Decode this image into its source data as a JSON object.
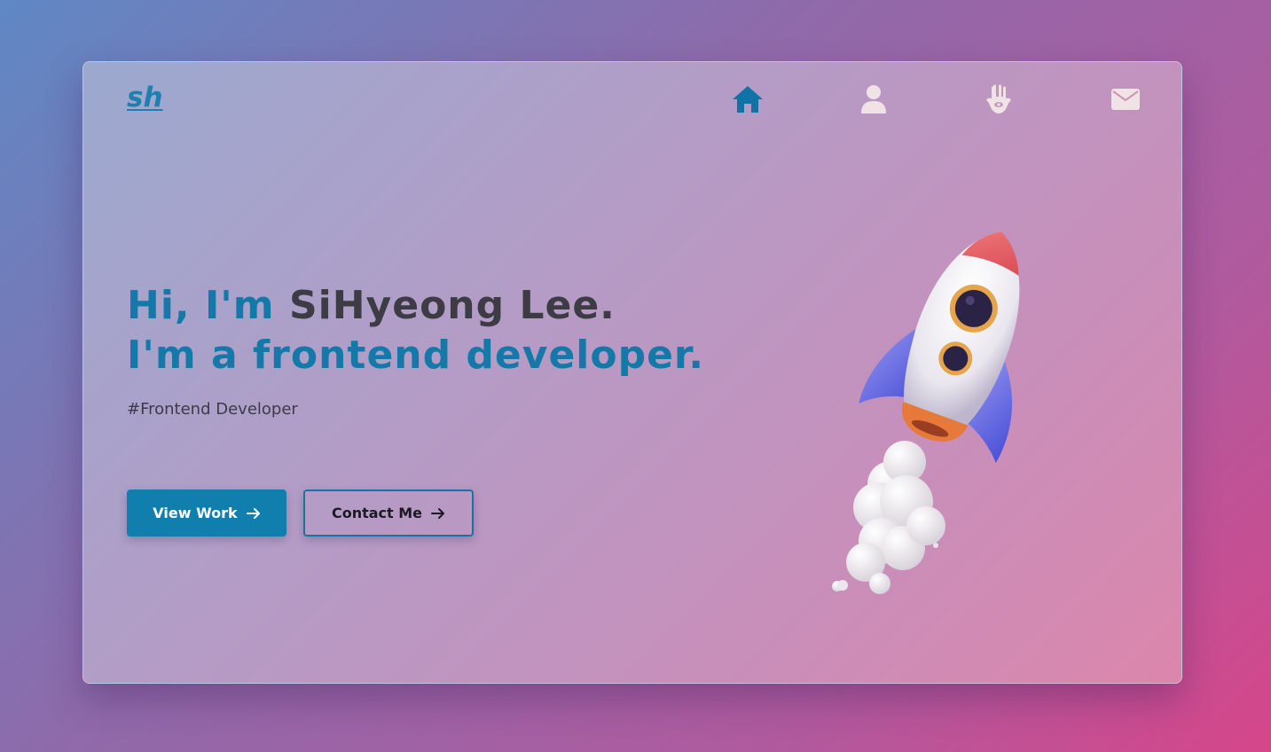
{
  "brand": {
    "logo": "sh"
  },
  "nav": {
    "items": [
      {
        "name": "home",
        "icon": "home-icon",
        "color": "#0f73a6"
      },
      {
        "name": "about",
        "icon": "user-icon",
        "color": "#f0e3e6"
      },
      {
        "name": "skills",
        "icon": "hamsa-icon",
        "color": "#f0e3e6"
      },
      {
        "name": "contact",
        "icon": "envelope-icon",
        "color": "#f0e3e6"
      }
    ]
  },
  "hero": {
    "greeting": "Hi, I'm ",
    "name": "SiHyeong Lee.",
    "role_line": "I'm a frontend developer.",
    "tagline": "#Frontend Developer",
    "primary_button": "View Work",
    "secondary_button": "Contact Me"
  },
  "colors": {
    "accent": "#117fae",
    "name_text": "#3d3b44"
  }
}
